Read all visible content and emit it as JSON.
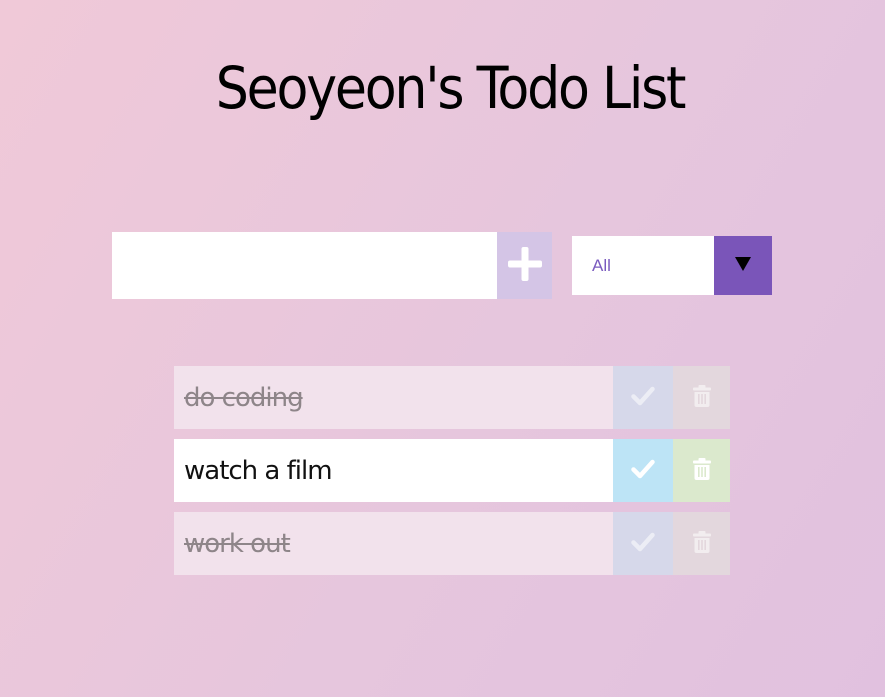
{
  "header": {
    "title": "Seoyeon's Todo List"
  },
  "add_form": {
    "input_value": "",
    "add_icon": "plus-icon"
  },
  "filter": {
    "selected": "All",
    "arrow_icon": "triangle-down-icon"
  },
  "todos": [
    {
      "text": "do coding",
      "completed": true
    },
    {
      "text": "watch a film",
      "completed": false
    },
    {
      "text": "work out",
      "completed": true
    }
  ],
  "colors": {
    "accent_purple": "#7a55b9",
    "add_button": "#d4c5e6",
    "check_button": "#bde4f6",
    "trash_button": "#dbe9cd",
    "filter_text": "#7a5bbf"
  }
}
